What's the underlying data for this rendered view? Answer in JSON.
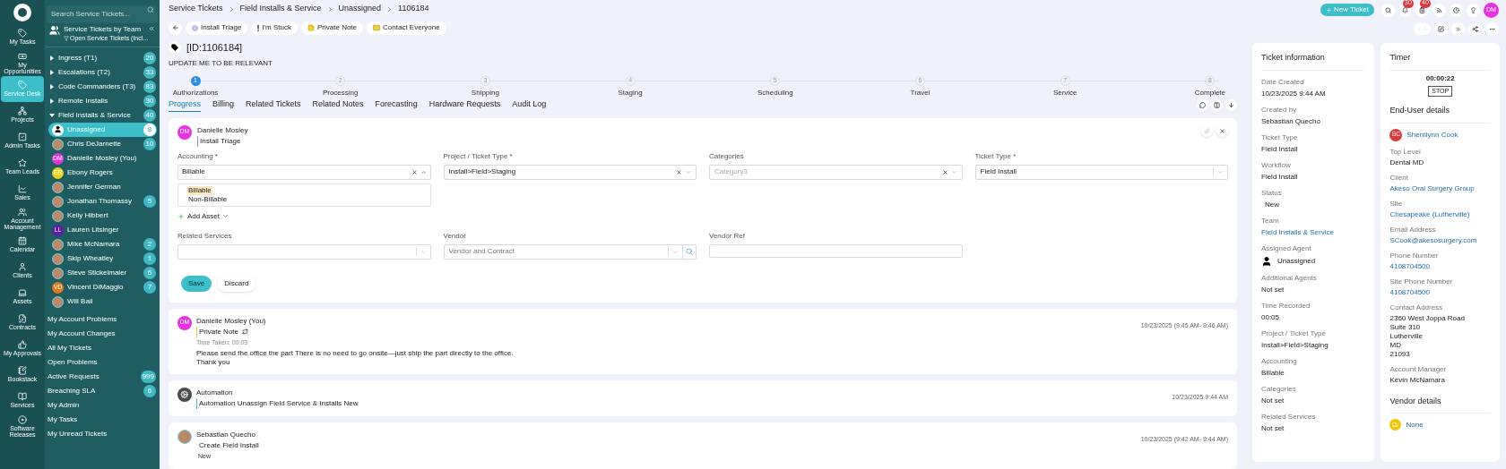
{
  "search": {
    "placeholder": "Search Service Tickets..."
  },
  "rail": [
    {
      "label": "My Tasks",
      "selected": false
    },
    {
      "label": "My Opportunities",
      "selected": false
    },
    {
      "label": "Service Desk",
      "selected": true
    },
    {
      "label": "Projects",
      "selected": false
    },
    {
      "label": "Admin Tasks",
      "selected": false
    },
    {
      "label": "Team Leads",
      "selected": false
    },
    {
      "label": "Sales",
      "selected": false
    },
    {
      "label": "Account Management",
      "selected": false
    },
    {
      "label": "Calendar",
      "selected": false
    },
    {
      "label": "Clients",
      "selected": false
    },
    {
      "label": "Assets",
      "selected": false
    },
    {
      "label": "Contracts",
      "selected": false
    },
    {
      "label": "My Approvals",
      "selected": false
    },
    {
      "label": "Bookstack",
      "selected": false
    },
    {
      "label": "Services",
      "selected": false
    },
    {
      "label": "Software Releases",
      "selected": false
    }
  ],
  "sidebar": {
    "title": "Service Tickets by Team",
    "subtitle": "Open Service Tickets (Incl...",
    "teams": [
      {
        "label": "Ingress (T1)",
        "count": "20",
        "expanded": false
      },
      {
        "label": "Escalations (T2)",
        "count": "33",
        "expanded": false
      },
      {
        "label": "Code Commanders (T3)",
        "count": "83",
        "expanded": false
      },
      {
        "label": "Remote Installs",
        "count": "30",
        "expanded": false
      },
      {
        "label": "Field Installs & Service",
        "count": "40",
        "expanded": true,
        "children": [
          {
            "name": "Unassigned",
            "avatar": {
              "kind": "silhouette"
            },
            "count": "8",
            "selected": true
          },
          {
            "name": "Chris DeJarnette",
            "avatar": {
              "kind": "photo"
            },
            "count": "10",
            "selected": false
          },
          {
            "name": "Danielle Mosley (You)",
            "avatar": {
              "kind": "initials",
              "initials": "DM",
              "color": "#e633e0"
            },
            "selected": false
          },
          {
            "name": "Ebony Rogers",
            "avatar": {
              "kind": "initials",
              "initials": "ER",
              "color": "#e8d21a"
            },
            "selected": false
          },
          {
            "name": "Jennifer German",
            "avatar": {
              "kind": "photo"
            },
            "selected": false
          },
          {
            "name": "Jonathan Thomassy",
            "avatar": {
              "kind": "photo"
            },
            "count": "5",
            "selected": false
          },
          {
            "name": "Kelly Hibbert",
            "avatar": {
              "kind": "photo"
            },
            "selected": false
          },
          {
            "name": "Lauren Litsinger",
            "avatar": {
              "kind": "initials",
              "initials": "LL",
              "color": "#5a1fa6"
            },
            "selected": false
          },
          {
            "name": "Mike McNamara",
            "avatar": {
              "kind": "photo"
            },
            "count": "2",
            "selected": false
          },
          {
            "name": "Skip Wheatley",
            "avatar": {
              "kind": "photo"
            },
            "count": "1",
            "selected": false
          },
          {
            "name": "Steve Stickelmaier",
            "avatar": {
              "kind": "photo"
            },
            "count": "6",
            "selected": false
          },
          {
            "name": "Vincent DiMaggio",
            "avatar": {
              "kind": "initials",
              "initials": "VD",
              "color": "#e37a1c"
            },
            "count": "7",
            "selected": false
          },
          {
            "name": "Will Ball",
            "avatar": {
              "kind": "photo"
            },
            "selected": false
          }
        ]
      }
    ],
    "views": [
      {
        "label": "My Account Problems"
      },
      {
        "label": "My Account Changes"
      },
      {
        "label": "All My Tickets"
      },
      {
        "label": "Open Problems"
      },
      {
        "label": "Active Requests",
        "count": "999"
      },
      {
        "label": "Breaching SLA",
        "count": "6"
      },
      {
        "label": "My Admin"
      },
      {
        "label": "My Tasks"
      },
      {
        "label": "My Unread Tickets"
      }
    ]
  },
  "breadcrumb": [
    "Service Tickets",
    "Field Installs & Service",
    "Unassigned",
    "1106184"
  ],
  "actions": [
    {
      "label": "Install Triage",
      "kind": "triage"
    },
    {
      "label": "I'm Stuck",
      "kind": "stuck"
    },
    {
      "label": "Private Note",
      "kind": "note"
    },
    {
      "label": "Contact Everyone",
      "kind": "everyone"
    }
  ],
  "header": {
    "new_ticket": "New Ticket",
    "notification_count": "30",
    "task_count": "40",
    "user_initials": "DM"
  },
  "ticket": {
    "id": "[ID:1106184]",
    "summary": "UPDATE ME TO BE RELEVANT"
  },
  "steps": [
    {
      "number": "1",
      "label": "Authorizations",
      "selected": true
    },
    {
      "number": "2",
      "label": "Processing",
      "selected": false
    },
    {
      "number": "3",
      "label": "Shipping",
      "selected": false
    },
    {
      "number": "4",
      "label": "Staging",
      "selected": false
    },
    {
      "number": "5",
      "label": "Scheduling",
      "selected": false
    },
    {
      "number": "6",
      "label": "Travel",
      "selected": false
    },
    {
      "number": "7",
      "label": "Service",
      "selected": false
    },
    {
      "number": "8",
      "label": "Complete",
      "selected": false
    }
  ],
  "tabs": [
    {
      "label": "Progress",
      "selected": true
    },
    {
      "label": "Billing",
      "selected": false
    },
    {
      "label": "Related Tickets",
      "selected": false
    },
    {
      "label": "Related Notes",
      "selected": false
    },
    {
      "label": "Forecasting",
      "selected": false
    },
    {
      "label": "Hardware Requests",
      "selected": false
    },
    {
      "label": "Audit Log",
      "selected": false
    }
  ],
  "form": {
    "author": "Danielle Mosley",
    "avatar": {
      "kind": "initials",
      "initials": "DM",
      "color": "#e633e0"
    },
    "action": "Install Triage",
    "accounting": {
      "label": "Accounting *",
      "value": "Billable",
      "options": [
        {
          "label": "Billable",
          "selected": true
        },
        {
          "label": "Non-Billable",
          "selected": false
        }
      ]
    },
    "project_type": {
      "label": "Project / Ticket Type *",
      "value": "Install>Field>Staging"
    },
    "categories": {
      "label": "Categories",
      "placeholder": "Category3"
    },
    "ticket_type": {
      "label": "Ticket Type *",
      "value": "Field Install"
    },
    "add_asset": "Add Asset",
    "related_services": {
      "label": "Related Services"
    },
    "vendor": {
      "label": "Vendor",
      "placeholder": "Vendor and Contract"
    },
    "vendor_ref": {
      "label": "Vendor Ref"
    },
    "save": "Save",
    "discard": "Discard"
  },
  "timeline": [
    {
      "author": "Danielle Mosley (You)",
      "avatar": {
        "kind": "initials",
        "initials": "DM",
        "color": "#e633e0"
      },
      "action": "Private Note",
      "kind": "note",
      "time_taken": "Time Taken: 00:03",
      "body": [
        "Please send the office the part There is no need to go onsite—just ship the part directly to the office.",
        "Thank you"
      ],
      "timestamp": "10/23/2025 (9:45 AM- 9:46 AM)"
    },
    {
      "author": "Automation",
      "avatar": {
        "kind": "gear"
      },
      "action": "Automation Unassign Field Service & Installs New",
      "kind": "automation",
      "timestamp": "10/23/2025 9:44 AM"
    },
    {
      "author": "Sebastian Quecho",
      "avatar": {
        "kind": "photo"
      },
      "action": "Create Field Install",
      "kind": "create",
      "status": "New",
      "timestamp": "10/23/2025 (9:42 AM- 9:44 AM)"
    }
  ],
  "ticket_info": {
    "title": "Ticket information",
    "fields": [
      {
        "label": "Date Created",
        "value": "10/23/2025 9:44 AM",
        "kind": "text"
      },
      {
        "label": "Created by",
        "value": "Sebastian Quecho",
        "kind": "text"
      },
      {
        "label": "Ticket Type",
        "value": "Field Install",
        "kind": "text"
      },
      {
        "label": "Workflow",
        "value": "Field Install",
        "kind": "text"
      },
      {
        "label": "Status",
        "value": "New",
        "kind": "status"
      },
      {
        "label": "Team",
        "value": "Field Installs & Service",
        "kind": "link"
      },
      {
        "label": "Assigned Agent",
        "value": "Unassigned",
        "kind": "agent"
      },
      {
        "label": "Additional Agents",
        "value": "Not set",
        "kind": "text"
      },
      {
        "label": "Time Recorded",
        "value": "00:05",
        "kind": "text"
      },
      {
        "label": "Project / Ticket Type",
        "value": "Install>Field>Staging",
        "kind": "text"
      },
      {
        "label": "Accounting",
        "value": "Billable",
        "kind": "text"
      },
      {
        "label": "Categories",
        "value": "Not set",
        "kind": "text"
      },
      {
        "label": "Related Services",
        "value": "Not set",
        "kind": "text"
      }
    ]
  },
  "timer": {
    "title": "Timer",
    "time": "00:00:22",
    "stop": "STOP"
  },
  "end_user": {
    "title": "End-User details",
    "contact": {
      "name": "Sherrilynn Cook",
      "initials": "SC",
      "color": "#d93a3a"
    },
    "fields": [
      {
        "label": "Top Level",
        "kind": "text",
        "lines": [
          "Dental MD"
        ]
      },
      {
        "label": "Client",
        "kind": "link",
        "lines": [
          "Akeso Oral Surgery Group"
        ]
      },
      {
        "label": "Site",
        "kind": "link",
        "lines": [
          "Chesapeake (Lutherville)"
        ]
      },
      {
        "label": "Email Address",
        "kind": "link",
        "lines": [
          "SCook@akesosurgery.com"
        ]
      },
      {
        "label": "Phone Number",
        "kind": "link",
        "lines": [
          "4108704500"
        ]
      },
      {
        "label": "Site Phone Number",
        "kind": "link",
        "lines": [
          "4108704500"
        ]
      },
      {
        "label": "Contact Address",
        "kind": "text",
        "lines": [
          "2360 West Joppa Road",
          "Suite 310",
          "Lutherville",
          "MD",
          "21093"
        ]
      },
      {
        "label": "Account Manager",
        "kind": "text",
        "lines": [
          "Kevin McNamara"
        ]
      }
    ]
  },
  "vendor_details": {
    "title": "Vendor details",
    "value": "None"
  }
}
